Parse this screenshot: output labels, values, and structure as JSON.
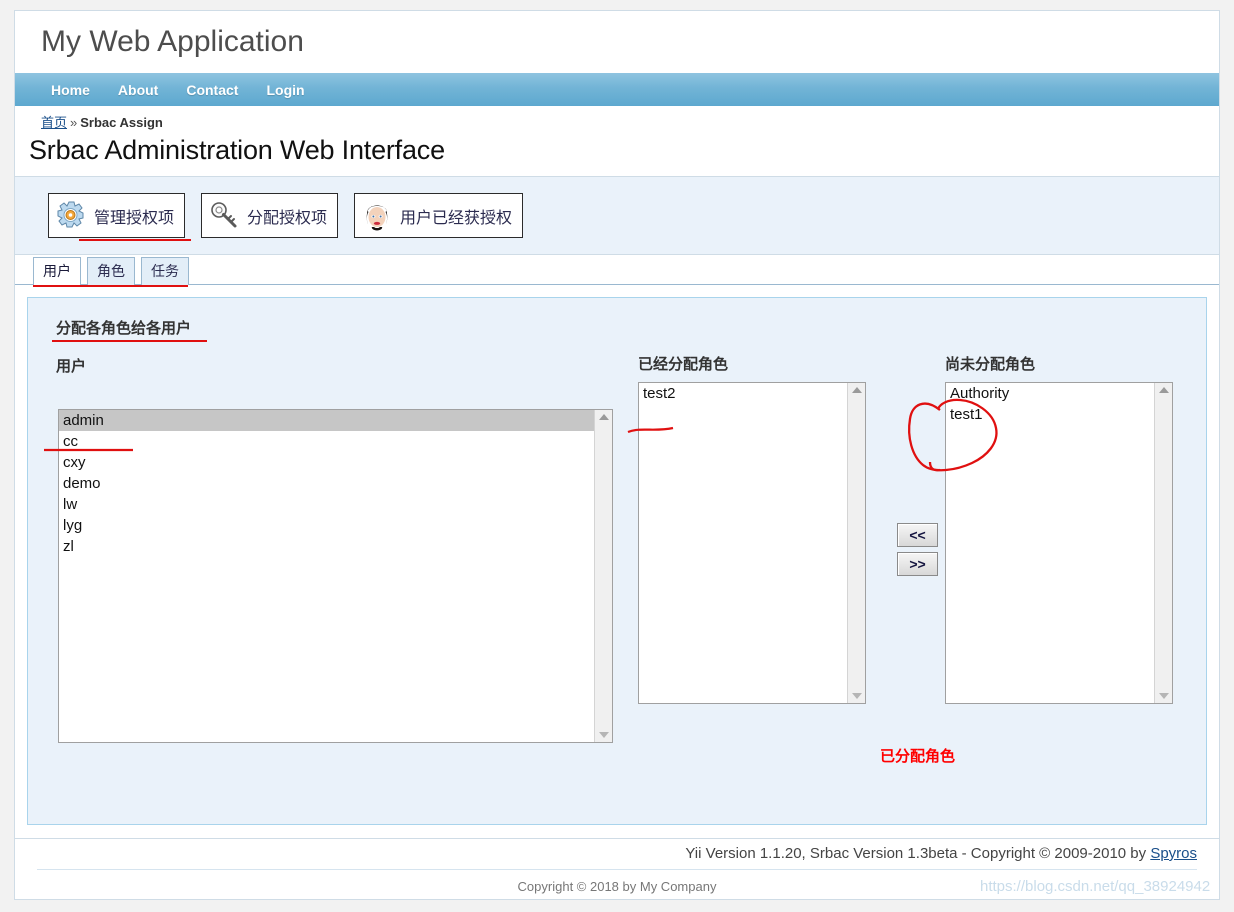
{
  "header": {
    "app_title": "My Web Application"
  },
  "nav": {
    "items": [
      {
        "label": "Home"
      },
      {
        "label": "About"
      },
      {
        "label": "Contact"
      },
      {
        "label": "Login"
      }
    ]
  },
  "breadcrumb": {
    "home_label": "首页",
    "separator": "»",
    "current": "Srbac Assign"
  },
  "page_title": "Srbac Administration Web Interface",
  "toolbar": {
    "buttons": [
      {
        "label": "管理授权项",
        "icon": "gear-icon"
      },
      {
        "label": "分配授权项",
        "icon": "key-icon"
      },
      {
        "label": "用户已经获授权",
        "icon": "user-face-icon"
      }
    ]
  },
  "tabs": [
    {
      "label": "用户",
      "active": true
    },
    {
      "label": "角色",
      "active": false
    },
    {
      "label": "任务",
      "active": false
    }
  ],
  "panel": {
    "title": "分配各角色给各用户",
    "user_label": "用户",
    "assigned_label": "已经分配角色",
    "unassigned_label": "尚未分配角色",
    "users": [
      {
        "label": "admin",
        "selected": true
      },
      {
        "label": "cc",
        "selected": false
      },
      {
        "label": "cxy",
        "selected": false
      },
      {
        "label": "demo",
        "selected": false
      },
      {
        "label": "lw",
        "selected": false
      },
      {
        "label": "lyg",
        "selected": false
      },
      {
        "label": "zl",
        "selected": false
      }
    ],
    "assigned_roles": [
      {
        "label": "test2",
        "selected": false
      }
    ],
    "unassigned_roles": [
      {
        "label": "Authority",
        "selected": false
      },
      {
        "label": "test1",
        "selected": false
      }
    ],
    "move_left_label": "<<",
    "move_right_label": ">>",
    "red_note": "已分配角色"
  },
  "footer": {
    "version_prefix": "Yii Version 1.1.20,  Srbac Version 1.3beta - Copyright © 2009-2010 by ",
    "version_link": "Spyros",
    "copyright": "Copyright © 2018 by My Company"
  },
  "watermark": {
    "text": "https://blog.csdn.net/qq_38924942"
  },
  "colors": {
    "nav_blue": "#72b4d6",
    "panel_bg": "#eaf2fa",
    "panel_border": "#a9d4ec",
    "annotation_red": "#e01010",
    "note_red": "#ff0000",
    "link_blue": "#1a4f8a"
  }
}
